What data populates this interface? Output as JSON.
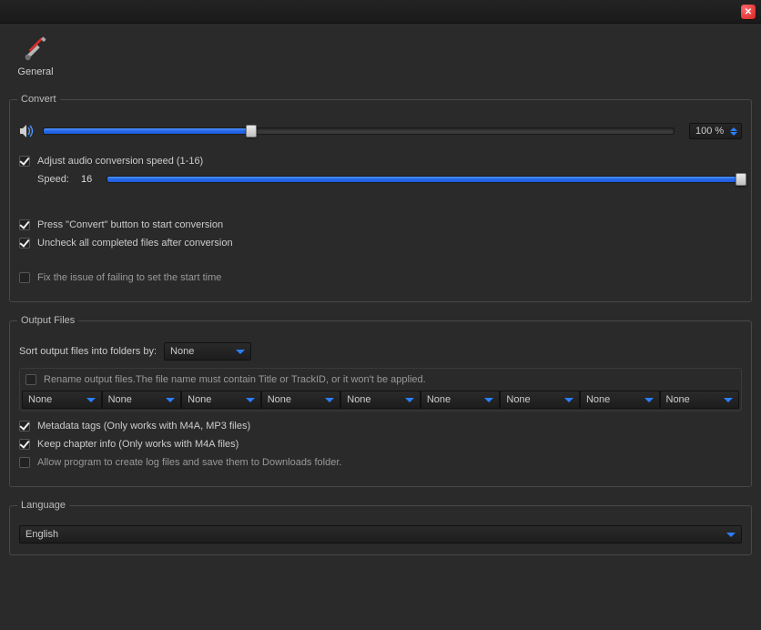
{
  "titlebar": {
    "close_title": "Close"
  },
  "tabs": {
    "general_label": "General"
  },
  "convert": {
    "legend": "Convert",
    "volume_percent": 33,
    "volume_spinner": "100 %",
    "adjust_speed_label": "Adjust audio conversion speed (1-16)",
    "adjust_speed_checked": true,
    "speed_label": "Speed:",
    "speed_value": "16",
    "speed_percent": 100,
    "press_convert_label": "Press \"Convert\" button to start conversion",
    "press_convert_checked": true,
    "uncheck_completed_label": "Uncheck all completed files after conversion",
    "uncheck_completed_checked": true,
    "fix_start_time_label": "Fix the issue of failing to set the start time",
    "fix_start_time_checked": false
  },
  "output": {
    "legend": "Output Files",
    "sort_label": "Sort output files into folders by:",
    "sort_value": "None",
    "rename_label": "Rename output files.The file name must contain Title or TrackID, or it won't be applied.",
    "rename_checked": false,
    "rename_fields": [
      "None",
      "None",
      "None",
      "None",
      "None",
      "None",
      "None",
      "None",
      "None"
    ],
    "metadata_label": "Metadata tags (Only works with M4A, MP3 files)",
    "metadata_checked": true,
    "chapter_label": "Keep chapter info (Only works with M4A files)",
    "chapter_checked": true,
    "log_label": "Allow program to create log files and save them to Downloads folder.",
    "log_checked": false
  },
  "language": {
    "legend": "Language",
    "value": "English"
  }
}
